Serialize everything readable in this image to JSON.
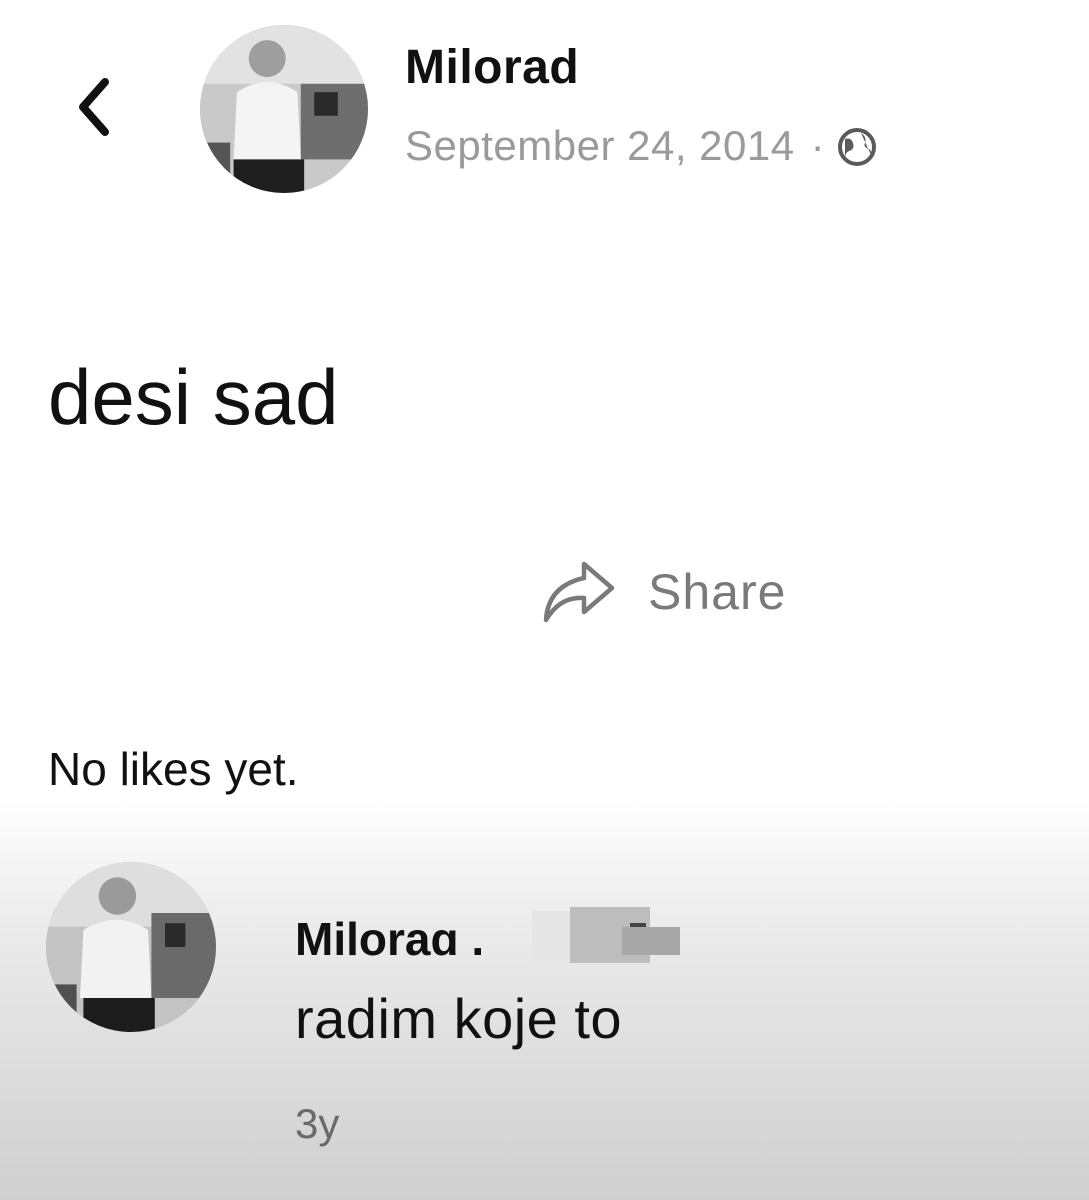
{
  "header": {
    "author": "Milorad",
    "date": "September 24, 2014",
    "separator": "·",
    "privacy_icon": "globe-icon",
    "back_icon": "chevron-left-icon"
  },
  "post": {
    "text": "desi sad",
    "share_label": "Share",
    "share_icon": "share-arrow-icon",
    "likes_text": "No likes yet."
  },
  "comment": {
    "author": "Miloraɑ .",
    "text": "radim koje to",
    "age": "3y"
  }
}
